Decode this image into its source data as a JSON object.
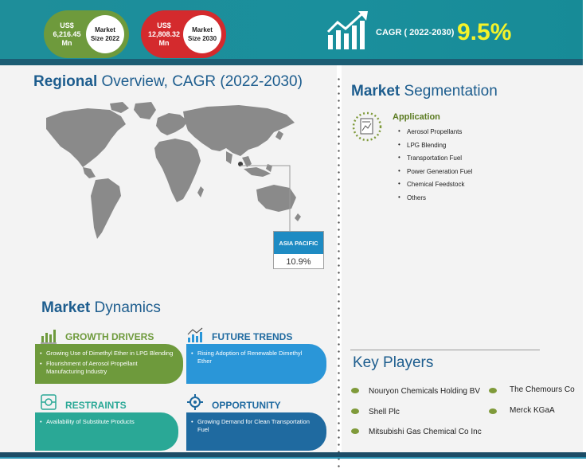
{
  "header": {
    "market_2022": {
      "value_line1": "US$",
      "value_line2": "6,216.45",
      "value_line3": "Mn",
      "label_line1": "Market",
      "label_line2": "Size 2022"
    },
    "market_2030": {
      "value_line1": "US$",
      "value_line2": "12,808.32",
      "value_line3": "Mn",
      "label_line1": "Market",
      "label_line2": "Size 2030"
    },
    "cagr_label": "CAGR ( 2022-2030)",
    "cagr_value": "9.5%"
  },
  "regional": {
    "title_bold": "Regional ",
    "title_rest": "Overview, CAGR (2022-2030)",
    "region_label": "ASIA PACIFIC",
    "region_value": "10.9%"
  },
  "segmentation": {
    "title_bold": "Market ",
    "title_rest": "Segmentation",
    "category": "Application",
    "items": [
      "Aerosol Propellants",
      "LPG Blending",
      "Transportation Fuel",
      "Power Generation Fuel",
      "Chemical Feedstock",
      "Others"
    ]
  },
  "dynamics": {
    "title_bold": "Market ",
    "title_rest": "Dynamics",
    "growth_drivers": {
      "heading": "GROWTH DRIVERS",
      "items": [
        "Growing Use of Dimethyl Ether in LPG Blending",
        "Flourishment of Aerosol Propellant Manufacturing Industry"
      ]
    },
    "future_trends": {
      "heading": "FUTURE TRENDS",
      "items": [
        "Rising Adoption of Renewable Dimethyl Ether"
      ]
    },
    "restraints": {
      "heading": "RESTRAINTS",
      "items": [
        "Availability of Substitute Products"
      ]
    },
    "opportunity": {
      "heading": "OPPORTUNITY",
      "items": [
        "Growing Demand for Clean Transportation Fuel"
      ]
    }
  },
  "key_players": {
    "title": "Key Players",
    "players": [
      "Nouryon Chemicals Holding BV",
      "The Chemours Co",
      "Shell Plc",
      "Merck KGaA",
      "Mitsubishi Gas Chemical Co Inc"
    ]
  },
  "colors": {
    "header": "#1a8f9c",
    "green_pill": "#6e9a3c",
    "red_pill": "#d42a2d",
    "cagr_value": "#f4f32a",
    "title_blue": "#1d5d8e",
    "growth": "#6e9a3c",
    "trends": "#2a96d8",
    "restraints": "#2aa896",
    "opportunity": "#1f6aa0"
  },
  "icons": [
    "growth-chart-icon",
    "world-map",
    "document-chart-icon",
    "bar-chart-icon",
    "trend-icon",
    "restraint-icon",
    "opportunity-gear-icon"
  ]
}
